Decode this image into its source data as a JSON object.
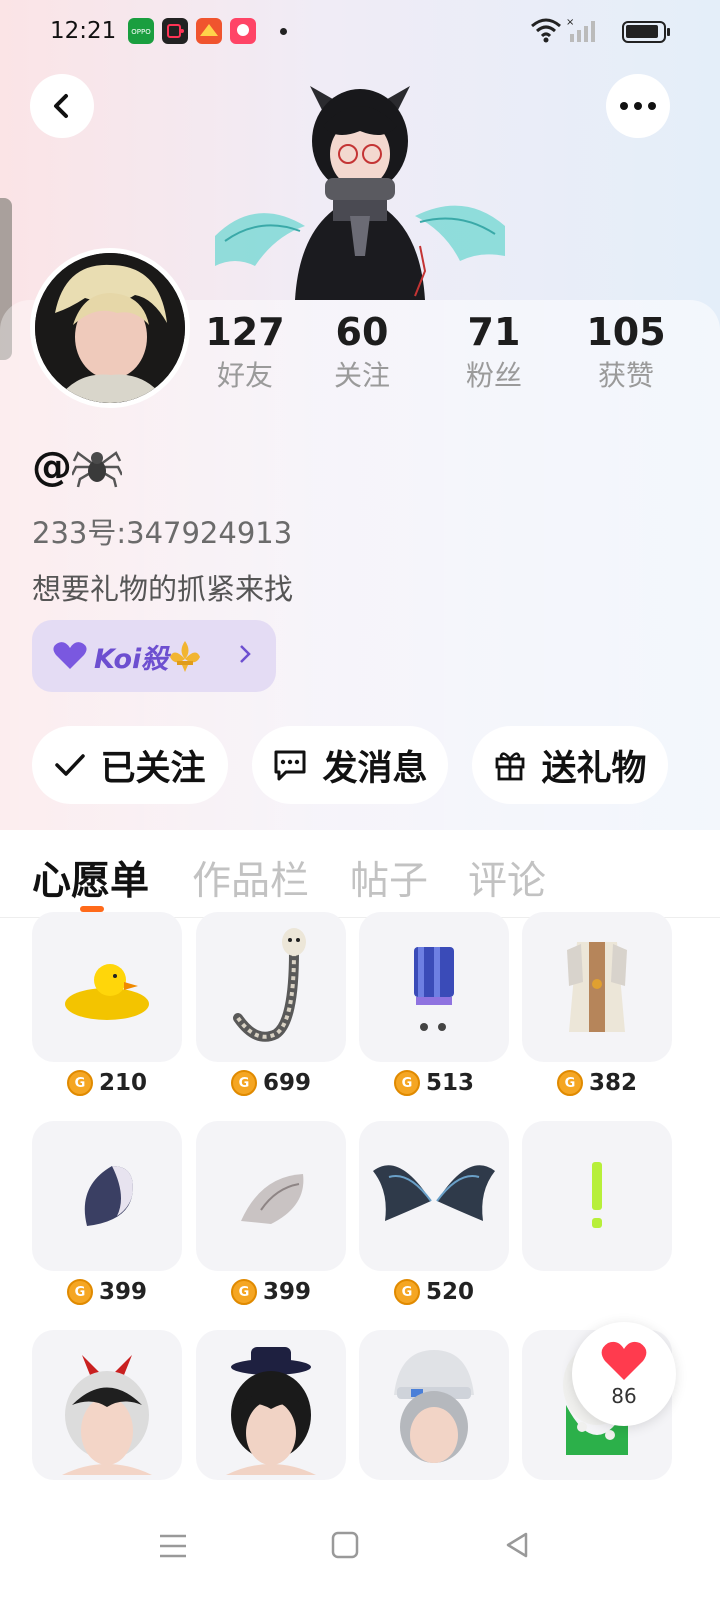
{
  "status_bar": {
    "time": "12:21",
    "notifications": [
      {
        "icon": "oppo-app-icon",
        "color": "#1a9e3f",
        "text": "OPPO"
      },
      {
        "icon": "video-app-icon",
        "color": "#222222",
        "text": ""
      },
      {
        "icon": "game-app-icon-1",
        "color": "#f0542e",
        "text": ""
      },
      {
        "icon": "game-app-icon-2",
        "color": "#ff4466",
        "text": ""
      }
    ],
    "battery_level": 0.8
  },
  "colors": {
    "accent": "#ff6a1a",
    "badge": "#6d4fd0",
    "coin": "#f5a623",
    "heart": "#ff3b4e"
  },
  "profile": {
    "stats": [
      {
        "value": "127",
        "label": "好友"
      },
      {
        "value": "60",
        "label": "关注"
      },
      {
        "value": "71",
        "label": "粉丝"
      },
      {
        "value": "105",
        "label": "获赞"
      }
    ],
    "username_prefix": "@",
    "username_icon": "spider-icon",
    "uid": "233号:347924913",
    "bio": "想要礼物的抓紧来找",
    "badge": {
      "text": "Koi殺",
      "icon": "heart-icon",
      "suffix_icon": "fleur-de-lis-icon"
    }
  },
  "actions": [
    {
      "label": "已关注",
      "icon": "check-icon"
    },
    {
      "label": "发消息",
      "icon": "chat-bubble-icon"
    },
    {
      "label": "送礼物",
      "icon": "gift-icon"
    }
  ],
  "tabs": [
    {
      "label": "心愿单",
      "active": true
    },
    {
      "label": "作品栏",
      "active": false
    },
    {
      "label": "帖子",
      "active": false
    },
    {
      "label": "评论",
      "active": false
    }
  ],
  "wishlist": [
    {
      "item": "yellow-duck-hat",
      "price": "210"
    },
    {
      "item": "snake-scarf",
      "price": "699"
    },
    {
      "item": "blue-skirt-set",
      "price": "513"
    },
    {
      "item": "white-robe-armor",
      "price": "382"
    },
    {
      "item": "gradient-tail",
      "price": "399"
    },
    {
      "item": "fluffy-tail",
      "price": "399"
    },
    {
      "item": "dark-wings",
      "price": "520"
    },
    {
      "item": "green-exclamation",
      "price": ""
    },
    {
      "item": "silver-hair-red-horns",
      "price": ""
    },
    {
      "item": "black-hair-hat",
      "price": ""
    },
    {
      "item": "beanie-headband",
      "price": ""
    },
    {
      "item": "frog-costume",
      "price": ""
    }
  ],
  "heart_fab": {
    "count": "86"
  }
}
